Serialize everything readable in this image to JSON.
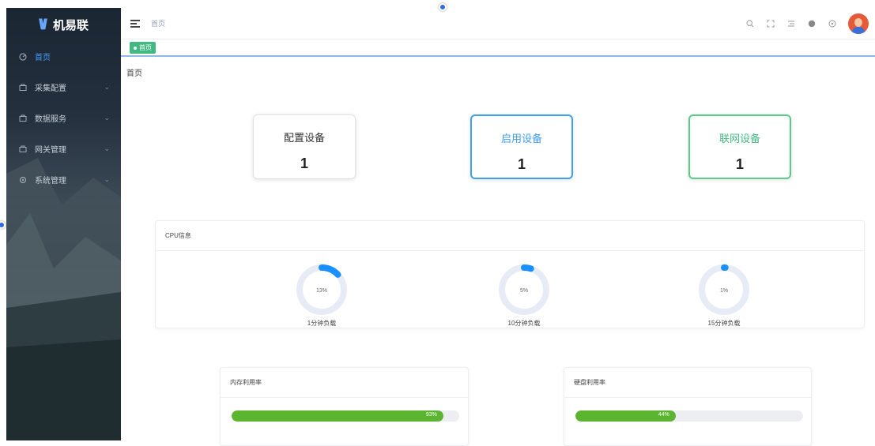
{
  "sidebar": {
    "logo_text": "机易联",
    "items": [
      {
        "label": "首页",
        "icon": "dashboard-icon",
        "active": true
      },
      {
        "label": "采集配置",
        "icon": "folder-icon",
        "expandable": true
      },
      {
        "label": "数据服务",
        "icon": "folder-icon",
        "expandable": true
      },
      {
        "label": "网关管理",
        "icon": "folder-icon",
        "expandable": true
      },
      {
        "label": "系统管理",
        "icon": "gear-icon",
        "expandable": true
      }
    ]
  },
  "topbar": {
    "breadcrumb": "首页",
    "icons": [
      "search-icon",
      "fullscreen-icon",
      "text-size-icon",
      "github-icon",
      "help-icon"
    ]
  },
  "tags": {
    "active": "首页"
  },
  "page_title": "首页",
  "stats": [
    {
      "label": "配置设备",
      "value": "1"
    },
    {
      "label": "启用设备",
      "value": "1"
    },
    {
      "label": "联网设备",
      "value": "1"
    }
  ],
  "cpu": {
    "title": "CPU信息",
    "gauges": [
      {
        "label": "1分钟负载",
        "percent_text": "13%",
        "percent": 13
      },
      {
        "label": "10分钟负载",
        "percent_text": "5%",
        "percent": 5
      },
      {
        "label": "15分钟负载",
        "percent_text": "1%",
        "percent": 1
      }
    ]
  },
  "memory": {
    "title": "内存利用率",
    "percent_text": "93%",
    "percent": 93
  },
  "disk": {
    "title": "硬盘利用率",
    "percent_text": "44%",
    "percent": 44
  },
  "colors": {
    "primary": "#409eff",
    "success": "#42b983",
    "progress": "#5cb531"
  }
}
